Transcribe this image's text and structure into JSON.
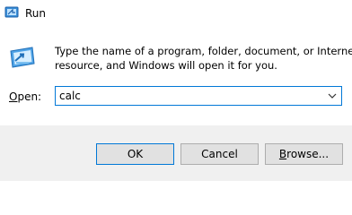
{
  "window": {
    "title": "Run",
    "title_icon": "run-icon"
  },
  "dialog": {
    "icon": "run-program-icon",
    "description_line1": "Type the name of a program, folder, document, or Internet",
    "description_line2": "resource, and Windows will open it for you.",
    "open_label_accel": "O",
    "open_label_rest": "pen:",
    "open_value": "calc",
    "dropdown_icon": "chevron-down-icon"
  },
  "buttons": {
    "ok_label": "OK",
    "cancel_label": "Cancel",
    "browse_accel": "B",
    "browse_rest": "rowse..."
  },
  "colors": {
    "accent": "#0078d7",
    "footer_bg": "#f0f0f0",
    "button_bg": "#e1e1e1",
    "button_border": "#adadad"
  }
}
